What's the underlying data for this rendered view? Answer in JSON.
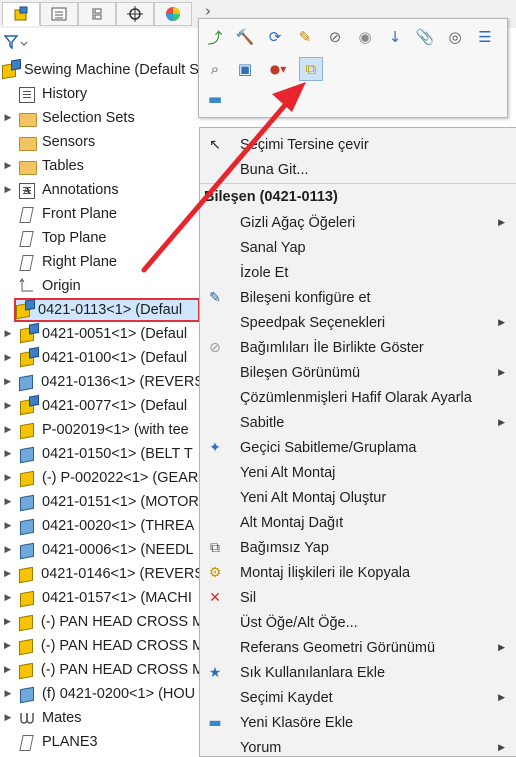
{
  "tabs": [
    {
      "name": "feature-manager-tab",
      "icon": "cube-icon"
    },
    {
      "name": "property-manager-tab",
      "icon": "list-icon"
    },
    {
      "name": "configuration-manager-tab",
      "icon": "config-icon"
    },
    {
      "name": "dimxpert-tab",
      "icon": "crosshair-icon"
    },
    {
      "name": "display-manager-tab",
      "icon": "color-wheel-icon"
    }
  ],
  "tree": [
    {
      "label": "Sewing Machine  (Default S",
      "icon": "assembly",
      "expander": false
    },
    {
      "label": "History",
      "icon": "history",
      "expander": false
    },
    {
      "label": "Selection Sets",
      "icon": "folder",
      "expander": true
    },
    {
      "label": "Sensors",
      "icon": "folder",
      "expander": false
    },
    {
      "label": "Tables",
      "icon": "folder",
      "expander": true
    },
    {
      "label": "Annotations",
      "icon": "annotation",
      "expander": true
    },
    {
      "label": "Front Plane",
      "icon": "plane",
      "expander": false
    },
    {
      "label": "Top Plane",
      "icon": "plane",
      "expander": false
    },
    {
      "label": "Right Plane",
      "icon": "plane",
      "expander": false
    },
    {
      "label": "Origin",
      "icon": "origin",
      "expander": false
    },
    {
      "label": "0421-0113<1> (Defaul",
      "icon": "subasm",
      "expander": true,
      "highlight": true
    },
    {
      "label": "0421-0051<1> (Defaul",
      "icon": "subasm",
      "expander": true
    },
    {
      "label": "0421-0100<1> (Defaul",
      "icon": "subasm",
      "expander": true
    },
    {
      "label": "0421-0136<1> (REVERS",
      "icon": "part-blue",
      "expander": true
    },
    {
      "label": "0421-0077<1> (Defaul",
      "icon": "subasm",
      "expander": true
    },
    {
      "label": "P-002019<1> (with tee",
      "icon": "part",
      "expander": true
    },
    {
      "label": "0421-0150<1> (BELT T",
      "icon": "part-blue",
      "expander": true
    },
    {
      "label": "(-) P-002022<1> (GEAR",
      "icon": "part",
      "expander": true
    },
    {
      "label": "0421-0151<1> (MOTOR",
      "icon": "part-blue",
      "expander": true
    },
    {
      "label": "0421-0020<1> (THREA",
      "icon": "part-blue",
      "expander": true
    },
    {
      "label": "0421-0006<1> (NEEDL",
      "icon": "part-blue",
      "expander": true
    },
    {
      "label": "0421-0146<1> (REVERS",
      "icon": "part",
      "expander": true
    },
    {
      "label": "0421-0157<1> (MACHI",
      "icon": "part",
      "expander": true
    },
    {
      "label": "(-) PAN HEAD CROSS M",
      "icon": "part",
      "expander": true
    },
    {
      "label": "(-) PAN HEAD CROSS M",
      "icon": "part",
      "expander": true
    },
    {
      "label": "(-) PAN HEAD CROSS M",
      "icon": "part",
      "expander": true
    },
    {
      "label": "(f) 0421-0200<1> (HOU",
      "icon": "part-blue",
      "expander": true
    },
    {
      "label": "Mates",
      "icon": "mates",
      "expander": true
    },
    {
      "label": "PLANE3",
      "icon": "plane",
      "expander": false
    }
  ],
  "toolbar": {
    "row1": [
      "edit-component-icon",
      "hammer-icon",
      "assembly-update-icon",
      "appearance-icon",
      "hide-icon",
      "show-icon",
      "move-component-icon",
      "paperclip-icon",
      "isolate-icon",
      "properties-icon"
    ],
    "row2": [
      "zoom-to-selection-icon",
      "open-part-icon",
      "appearance-dropdown-icon",
      "make-independent-icon"
    ],
    "row3": [
      "folder-icon"
    ]
  },
  "menu": {
    "top_items": [
      {
        "label": "Seçimi Tersine çevir",
        "icon": "cursor-icon"
      },
      {
        "label": "Buna Git...",
        "icon": ""
      }
    ],
    "header": "Bileşen (0421-0113)",
    "items": [
      {
        "label": "Gizli Ağaç Öğeleri",
        "icon": "",
        "submenu": true
      },
      {
        "label": "Sanal Yap",
        "icon": "",
        "submenu": false
      },
      {
        "label": "İzole Et",
        "icon": "",
        "submenu": false
      },
      {
        "label": "Bileşeni konfigüre et",
        "icon": "pencil-icon",
        "submenu": false
      },
      {
        "label": "Speedpak Seçenekleri",
        "icon": "",
        "submenu": true
      },
      {
        "label": "Bağımlıları İle Birlikte Göster",
        "icon": "eye-slash-icon",
        "submenu": false
      },
      {
        "label": "Bileşen Görünümü",
        "icon": "",
        "submenu": true
      },
      {
        "label": "Çözümlenmişleri Hafif Olarak Ayarla",
        "icon": "",
        "submenu": false
      },
      {
        "label": "Sabitle",
        "icon": "",
        "submenu": true
      },
      {
        "label": "Geçici Sabitleme/Gruplama",
        "icon": "float-icon",
        "submenu": false
      },
      {
        "label": "Yeni Alt Montaj",
        "icon": "",
        "submenu": false
      },
      {
        "label": "Yeni Alt Montaj Oluştur",
        "icon": "",
        "submenu": false
      },
      {
        "label": "Alt Montaj Dağıt",
        "icon": "",
        "submenu": false
      },
      {
        "label": "Bağımsız Yap",
        "icon": "independent-icon",
        "submenu": false
      },
      {
        "label": "Montaj İlişkileri ile Kopyala",
        "icon": "copy-mates-icon",
        "submenu": false
      },
      {
        "label": "Sil",
        "icon": "delete-icon",
        "submenu": false
      },
      {
        "label": "Üst Öğe/Alt Öğe...",
        "icon": "",
        "submenu": false
      },
      {
        "label": "Referans Geometri Görünümü",
        "icon": "",
        "submenu": true
      },
      {
        "label": "Sık Kullanılanlara Ekle",
        "icon": "favorite-icon",
        "submenu": false
      },
      {
        "label": "Seçimi Kaydet",
        "icon": "",
        "submenu": true
      },
      {
        "label": "Yeni Klasöre Ekle",
        "icon": "folder-icon",
        "submenu": false
      },
      {
        "label": "Yorum",
        "icon": "",
        "submenu": true
      }
    ]
  },
  "colors": {
    "highlight_border": "#e0303a",
    "arrow": "#e8242c",
    "selected_bg": "#cfe6ff"
  }
}
